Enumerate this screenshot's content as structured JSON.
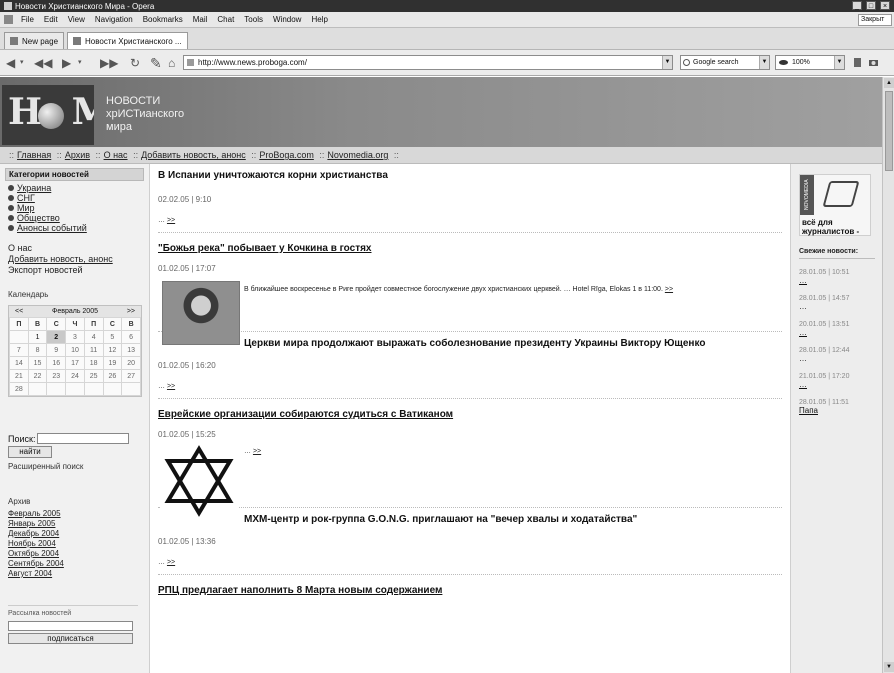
{
  "window": {
    "title": "Новости Христианского Мира - Opera"
  },
  "menu": [
    "File",
    "Edit",
    "View",
    "Navigation",
    "Bookmarks",
    "Mail",
    "Chat",
    "Tools",
    "Window",
    "Help"
  ],
  "menu_right_box": "Закрыт",
  "tabs": [
    {
      "label": "New page",
      "active": false
    },
    {
      "label": "Новости Христианского ...",
      "active": true
    }
  ],
  "address": {
    "url": "http://www.news.proboga.com/",
    "search_placeholder": "Google search",
    "zoom": "100%"
  },
  "site": {
    "name_lines": [
      "НОВОСТИ",
      "хрИСТианского",
      "мира"
    ],
    "topnav": [
      "Главная",
      "Архив",
      "О нас",
      "Добавить новость, анонс",
      "ProBoga.com",
      "Novomedia.org"
    ]
  },
  "left": {
    "categories_title": "Категории новостей",
    "categories": [
      "Украина",
      "СНГ",
      "Мир",
      "Общество",
      "Анонсы событий"
    ],
    "links": [
      {
        "text": "О нас",
        "underlined": false
      },
      {
        "text": "Добавить новость, анонс",
        "underlined": true
      },
      {
        "text": "Экспорт новостей",
        "underlined": false
      }
    ],
    "calendar_label": "Календарь",
    "calendar": {
      "prev": "<<",
      "month": "Февраль 2005",
      "next": ">>",
      "weekdays": [
        "П",
        "В",
        "С",
        "Ч",
        "П",
        "С",
        "В"
      ],
      "rows": [
        [
          "",
          "1",
          "2",
          "3",
          "4",
          "5",
          "6"
        ],
        [
          "7",
          "8",
          "9",
          "10",
          "11",
          "12",
          "13"
        ],
        [
          "14",
          "15",
          "16",
          "17",
          "18",
          "19",
          "20"
        ],
        [
          "21",
          "22",
          "23",
          "24",
          "25",
          "26",
          "27"
        ],
        [
          "28",
          "",
          "",
          "",
          "",
          "",
          ""
        ]
      ],
      "selected": "2"
    },
    "search_label": "Поиск:",
    "search_button": "найти",
    "advanced_search": "Расширенный поиск",
    "archive_title": "Архив",
    "archive": [
      "Февраль 2005",
      "Январь 2005",
      "Декабрь 2004",
      "Ноябрь 2004",
      "Октябрь 2004",
      "Сентябрь 2004",
      "Август 2004"
    ],
    "subscribe_label": "Рассылка новостей",
    "subscribe_button": "подписаться"
  },
  "articles": [
    {
      "title": "В Испании уничтожаются корни христианства",
      "date": "02.02.05 | 9:10",
      "body": "…",
      "more": ">>"
    },
    {
      "title": "\"Божья река\" побывает у Кочкина в гостях",
      "date": "01.02.05 | 17:07",
      "body": "В ближайшее воскресенье в Риге пройдет совместное богослужение двух христианских церквей. … Hotel Rīga, Elokas 1 в 11:00.",
      "more": ">>"
    },
    {
      "title": "Церкви мира продолжают выражать соболезнование президенту Украины Виктору Ющенко",
      "date": "01.02.05 | 16:20",
      "body": "…",
      "more": ">>"
    },
    {
      "title": "Еврейские организации собираются судиться с Ватиканом",
      "date": "01.02.05 | 15:25",
      "body": "…",
      "more": ">>"
    },
    {
      "title": "МХМ-центр и рок-группа G.O.N.G. приглашают на \"вечер хвалы и ходатайства\"",
      "date": "01.02.05 | 13:36",
      "body": "…",
      "more": ">>"
    },
    {
      "title": "РПЦ предлагает наполнить 8 Марта новым содержанием",
      "date": "",
      "body": "",
      "more": ""
    }
  ],
  "right": {
    "promo_side": "NOVOMEDIA",
    "promo_text_lines": [
      "всё для",
      "журналистов -"
    ],
    "news_title": "Свежие новости:",
    "news": [
      {
        "date": "28.01.05 | 10:51",
        "title": "…"
      },
      {
        "date": "28.01.05 | 14:57",
        "title": "…"
      },
      {
        "date": "20.01.05 | 13:51",
        "title": "…"
      },
      {
        "date": "28.01.05 | 12:44",
        "title": "…"
      },
      {
        "date": "21.01.05 | 17:20",
        "title": "…"
      },
      {
        "date": "28.01.05 | 11:51",
        "title": "Папа"
      }
    ]
  }
}
